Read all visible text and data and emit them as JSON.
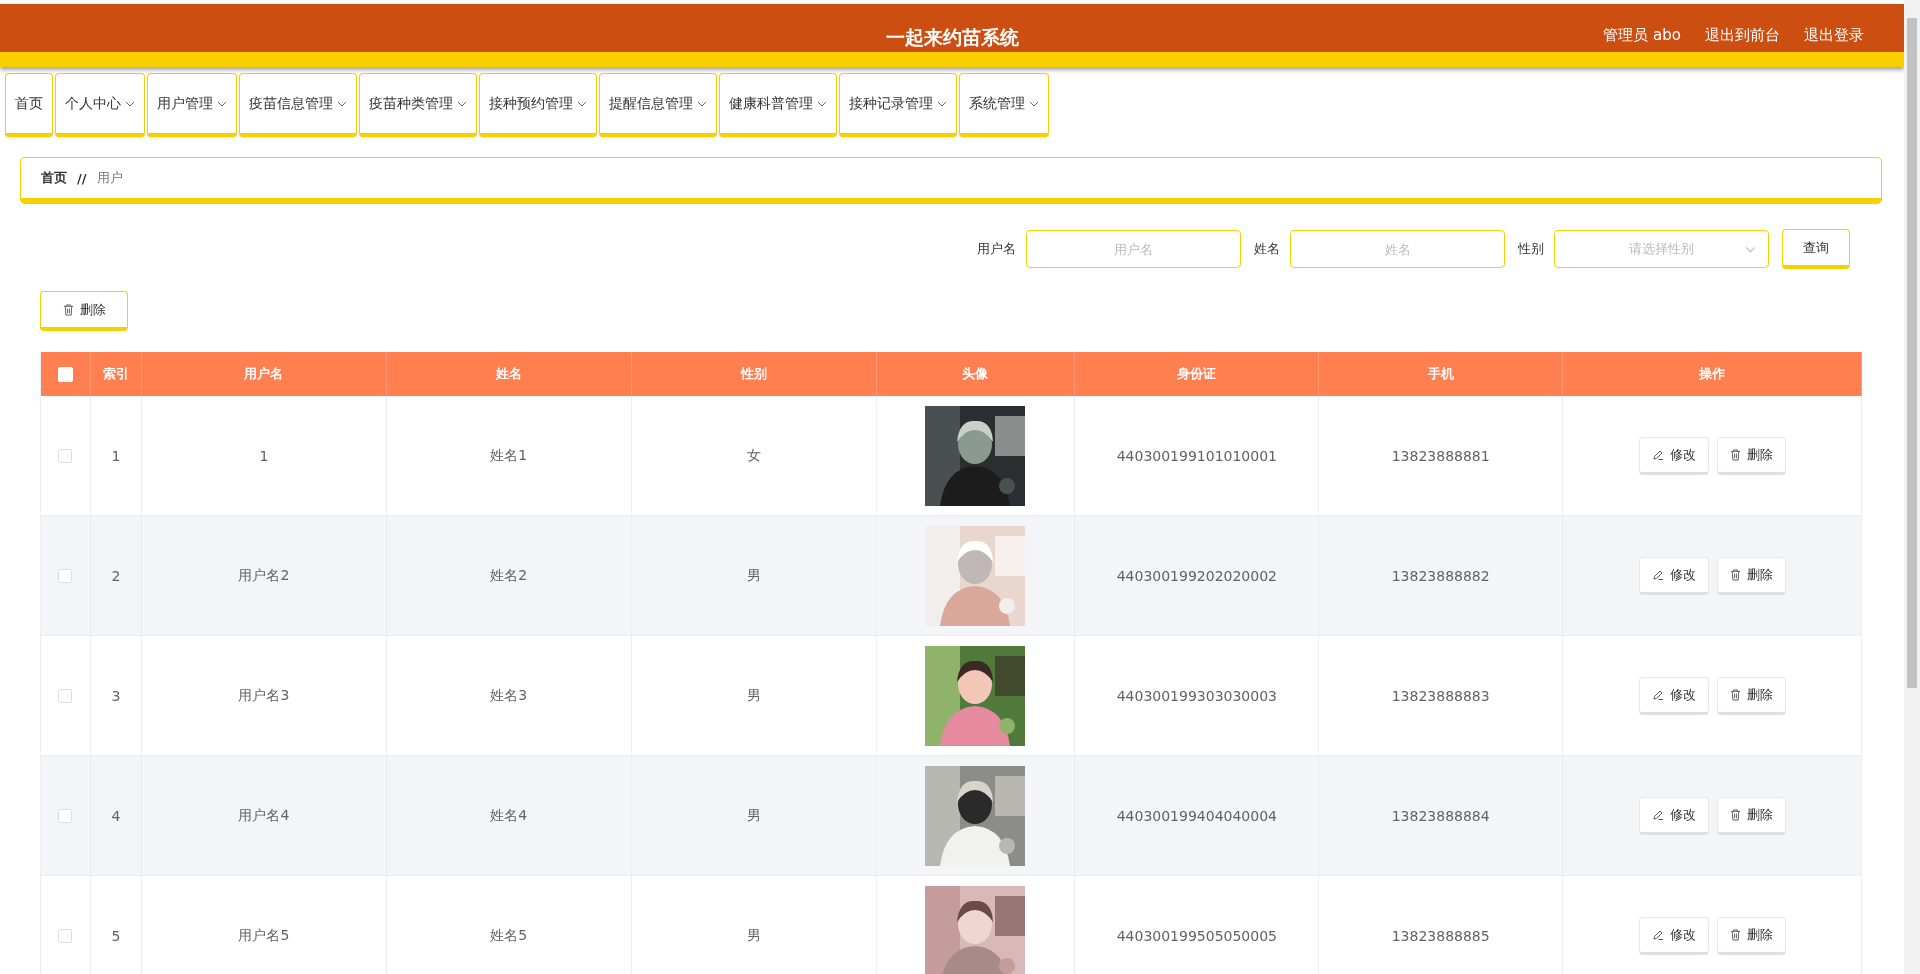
{
  "header": {
    "title": "一起来约苗系统",
    "links": [
      "管理员 abo",
      "退出到前台",
      "退出登录"
    ]
  },
  "nav": [
    {
      "label": "首页",
      "has_menu": false
    },
    {
      "label": "个人中心",
      "has_menu": true
    },
    {
      "label": "用户管理",
      "has_menu": true
    },
    {
      "label": "疫苗信息管理",
      "has_menu": true
    },
    {
      "label": "疫苗种类管理",
      "has_menu": true
    },
    {
      "label": "接种预约管理",
      "has_menu": true
    },
    {
      "label": "提醒信息管理",
      "has_menu": true
    },
    {
      "label": "健康科普管理",
      "has_menu": true
    },
    {
      "label": "接种记录管理",
      "has_menu": true
    },
    {
      "label": "系统管理",
      "has_menu": true
    }
  ],
  "breadcrumb": {
    "items": [
      "首页",
      "用户"
    ],
    "separator": "//"
  },
  "search": {
    "fields": [
      {
        "kind": "text",
        "label": "用户名",
        "placeholder": "用户名"
      },
      {
        "kind": "text",
        "label": "姓名",
        "placeholder": "姓名"
      },
      {
        "kind": "select",
        "label": "性别",
        "placeholder": "请选择性别"
      }
    ],
    "button": "查询"
  },
  "toolbar": {
    "delete_button": "删除"
  },
  "table": {
    "all_checked": false,
    "columns": [
      "索引",
      "用户名",
      "姓名",
      "性别",
      "头像",
      "身份证",
      "手机",
      "操作"
    ],
    "rows": [
      {
        "checked": false,
        "index": "1",
        "username": "1",
        "name": "姓名1",
        "gender": "女",
        "avatar": {
          "kind": "picture"
        },
        "id_card": "440300199101010001",
        "phone": "13823888881",
        "actions": [
          "修改",
          "删除"
        ]
      },
      {
        "checked": false,
        "index": "2",
        "username": "用户名2",
        "name": "姓名2",
        "gender": "男",
        "avatar": {
          "kind": "picture"
        },
        "id_card": "440300199202020002",
        "phone": "13823888882",
        "actions": [
          "修改",
          "删除"
        ]
      },
      {
        "checked": false,
        "index": "3",
        "username": "用户名3",
        "name": "姓名3",
        "gender": "男",
        "avatar": {
          "kind": "picture"
        },
        "id_card": "440300199303030003",
        "phone": "13823888883",
        "actions": [
          "修改",
          "删除"
        ]
      },
      {
        "checked": false,
        "index": "4",
        "username": "用户名4",
        "name": "姓名4",
        "gender": "男",
        "avatar": {
          "kind": "picture"
        },
        "id_card": "440300199404040004",
        "phone": "13823888884",
        "actions": [
          "修改",
          "删除"
        ]
      },
      {
        "checked": false,
        "index": "5",
        "username": "用户名5",
        "name": "姓名5",
        "gender": "男",
        "avatar": {
          "kind": "picture"
        },
        "id_card": "440300199505050005",
        "phone": "13823888885",
        "actions": [
          "修改",
          "删除"
        ]
      }
    ]
  }
}
